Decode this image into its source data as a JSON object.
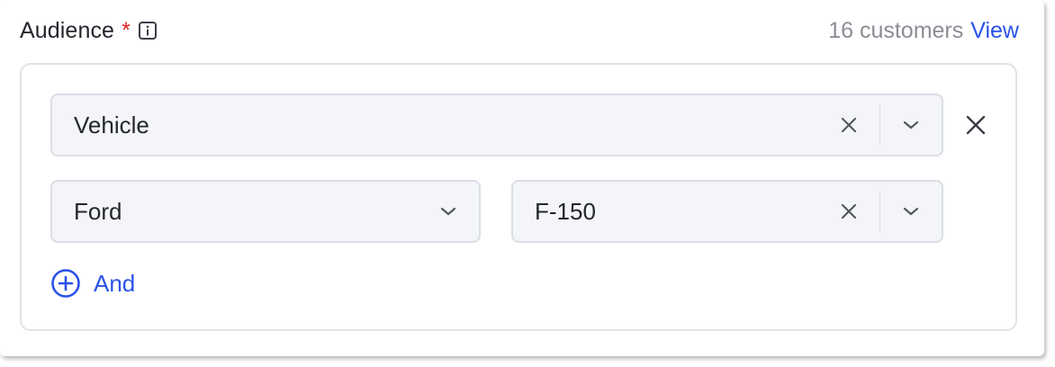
{
  "header": {
    "title": "Audience",
    "required_mark": "*",
    "info_icon": "info-icon",
    "customer_count": "16 customers",
    "view_link": "View"
  },
  "conditions": {
    "attribute": {
      "value": "Vehicle",
      "clear_icon": "close-icon",
      "expand_icon": "chevron-down-icon"
    },
    "remove_icon": "close-icon",
    "make": {
      "value": "Ford",
      "expand_icon": "chevron-down-icon"
    },
    "model": {
      "value": "F-150",
      "clear_icon": "close-icon",
      "expand_icon": "chevron-down-icon"
    }
  },
  "add_condition": {
    "label": "And",
    "icon": "plus-circle-icon"
  },
  "colors": {
    "accent": "#2a52e8",
    "required": "#e01e1e",
    "muted_text": "#8a8d96",
    "field_bg": "#f4f5f9",
    "border": "#dcdee5"
  }
}
